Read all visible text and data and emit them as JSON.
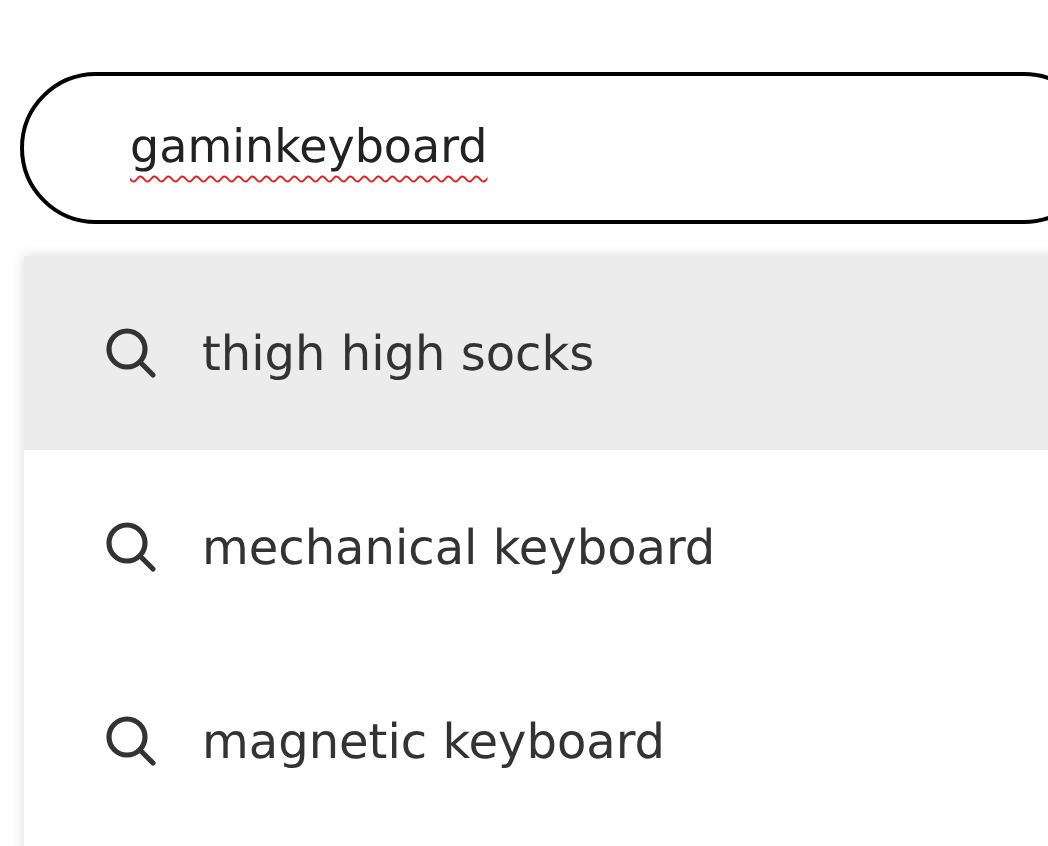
{
  "search": {
    "value": "gaminkeyboard",
    "misspelled": true
  },
  "suggestions": [
    {
      "label": "thigh high socks",
      "selected": true
    },
    {
      "label": "mechanical keyboard",
      "selected": false
    },
    {
      "label": "magnetic keyboard",
      "selected": false
    }
  ]
}
